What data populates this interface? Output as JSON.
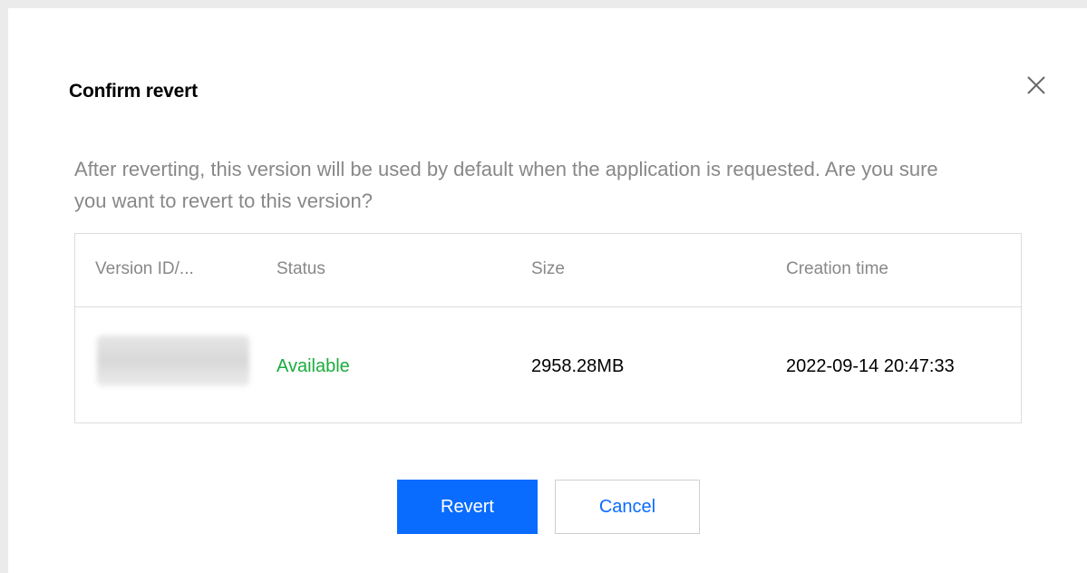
{
  "dialog": {
    "title": "Confirm revert",
    "close_icon": "close-icon",
    "description": "After reverting, this version will be used by default when the application is requested. Are you sure you want to revert to this version?"
  },
  "table": {
    "columns": [
      "Version ID/...",
      "Status",
      "Size",
      "Creation time"
    ],
    "rows": [
      {
        "version_id": "",
        "status": "Available",
        "size": "2958.28MB",
        "creation_time": "2022-09-14 20:47:33"
      }
    ]
  },
  "buttons": {
    "revert_label": "Revert",
    "cancel_label": "Cancel"
  },
  "colors": {
    "primary": "#0a6cff",
    "status_available": "#1aac3c",
    "muted_text": "#888888",
    "border": "#dddddd"
  }
}
